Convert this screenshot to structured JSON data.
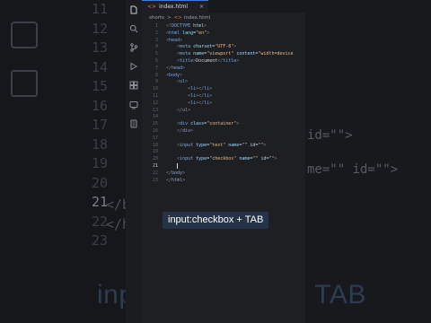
{
  "background": {
    "line_numbers": [
      "11",
      "12",
      "13",
      "14",
      "15",
      "16",
      "17",
      "18",
      "19",
      "20",
      "21",
      "22",
      "23"
    ],
    "active_line": "21",
    "code_lines": [
      "</b",
      "</h"
    ],
    "frag_id": "id=\"\">",
    "frag_name": "me=\"\" id=\"\">",
    "caption": "input:checkbox + TAB"
  },
  "tab": {
    "label": "index.html",
    "icon": "html-file-icon",
    "close": "×"
  },
  "breadcrumb": {
    "folder": "shorts",
    "separator": ">",
    "file": "index.html"
  },
  "editor": {
    "active_line": "21",
    "lines": [
      {
        "n": "1"
      },
      {
        "n": "2"
      },
      {
        "n": "3"
      },
      {
        "n": "4"
      },
      {
        "n": "5"
      },
      {
        "n": "6"
      },
      {
        "n": "7"
      },
      {
        "n": "8"
      },
      {
        "n": "9"
      },
      {
        "n": "10"
      },
      {
        "n": "11"
      },
      {
        "n": "12"
      },
      {
        "n": "13"
      },
      {
        "n": "14"
      },
      {
        "n": "15"
      },
      {
        "n": "16"
      },
      {
        "n": "17"
      },
      {
        "n": "18"
      },
      {
        "n": "19"
      },
      {
        "n": "20"
      },
      {
        "n": "21"
      },
      {
        "n": "22"
      },
      {
        "n": "23"
      }
    ]
  },
  "overlay": {
    "text": "input:checkbox  + TAB"
  },
  "colors": {
    "accent": "#3c7ddc",
    "overlay_bg": "#253348",
    "panel_bg": "#1e1f22"
  },
  "activity_icons": [
    "files-icon",
    "search-icon",
    "source-control-icon",
    "run-debug-icon",
    "extensions-icon",
    "remote-icon",
    "bookmark-icon"
  ]
}
